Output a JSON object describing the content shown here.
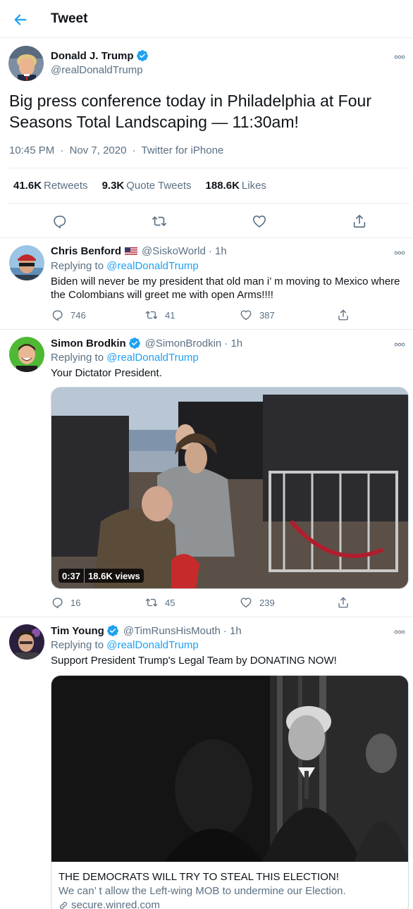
{
  "header": {
    "back_icon": "arrow-left-icon",
    "title": "Tweet"
  },
  "colors": {
    "accent": "#1da1f2",
    "secondary_text": "#5b7083",
    "border": "#e6ecf0",
    "verified": "#1da1f2",
    "text": "#0f1419"
  },
  "main_tweet": {
    "name": "Donald J. Trump",
    "verified": true,
    "handle": "@realDonaldTrump",
    "text": "Big press conference today in Philadelphia at Four Seasons Total Landscaping — 11:30am!",
    "time": "10:45 PM",
    "date": "Nov 7, 2020",
    "source": "Twitter for iPhone",
    "sep": "·",
    "stats": [
      {
        "count": "41.6K",
        "label": "Retweets"
      },
      {
        "count": "9.3K",
        "label": "Quote Tweets"
      },
      {
        "count": "188.6K",
        "label": "Likes"
      }
    ]
  },
  "replies": [
    {
      "name": "Chris Benford",
      "flag_icon": "us-flag-icon",
      "handle": "@SiskoWorld",
      "time": "· 1h",
      "replying_prefix": "Replying to",
      "replying_to": "@realDonaldTrump",
      "text": "Biden will never be my president that old man i’ m moving to Mexico where the Colombians will greet me with open Arms!!!!",
      "reply_count": "746",
      "retweet_count": "41",
      "like_count": "387"
    },
    {
      "name": "Simon Brodkin",
      "verified": true,
      "handle": "@SimonBrodkin",
      "time": "· 1h",
      "replying_prefix": "Replying to",
      "replying_to": "@realDonaldTrump",
      "text": "Your Dictator President.",
      "video_duration": "0:37",
      "video_views": "18.6K views",
      "reply_count": "16",
      "retweet_count": "45",
      "like_count": "239"
    },
    {
      "name": "Tim Young",
      "verified": true,
      "handle": "@TimRunsHisMouth",
      "time": "· 1h",
      "replying_prefix": "Replying to",
      "replying_to": "@realDonaldTrump",
      "text": "Support President Trump's Legal Team by DONATING NOW!",
      "card_title": "THE DEMOCRATS WILL TRY TO STEAL THIS ELECTION!",
      "card_description": "We can’ t allow the Left-wing MOB to undermine our Election.",
      "card_domain": "secure.winred.com",
      "card_link_icon": "link-icon"
    }
  ]
}
